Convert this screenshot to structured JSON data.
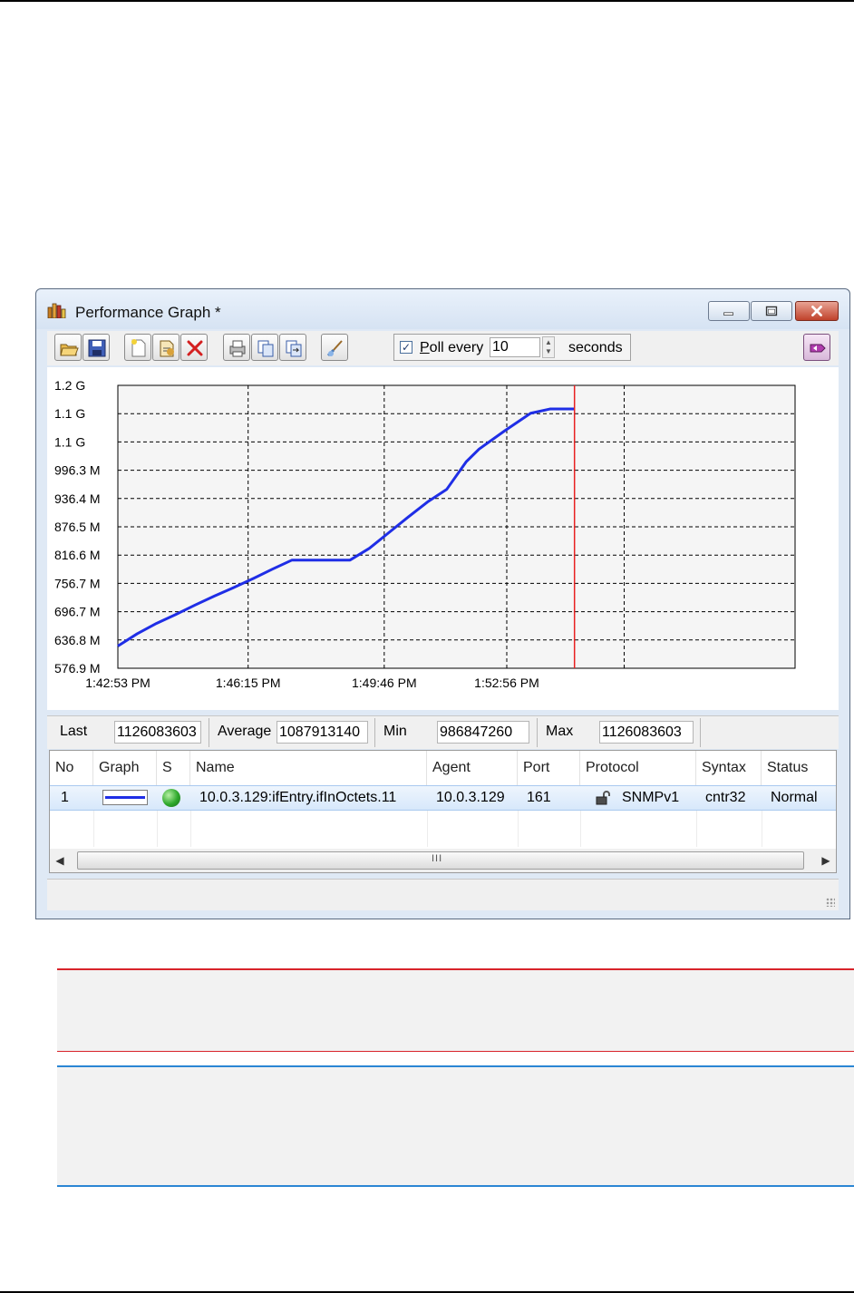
{
  "window": {
    "title": "Performance Graph *",
    "icons": {
      "app": "bar-chart-icon",
      "minimize": "minimize-icon",
      "maximize": "maximize-icon",
      "close": "close-icon"
    }
  },
  "toolbar": {
    "buttons": [
      {
        "icon": "open-folder-icon"
      },
      {
        "icon": "save-icon"
      },
      {
        "icon": "new-document-icon"
      },
      {
        "icon": "add-variable-icon"
      },
      {
        "icon": "delete-icon"
      },
      {
        "icon": "print-icon"
      },
      {
        "icon": "copy-icon"
      },
      {
        "icon": "export-icon"
      },
      {
        "icon": "properties-icon"
      },
      {
        "icon": "help-icon"
      }
    ],
    "poll": {
      "checked": true,
      "label_underlined": "P",
      "label_rest": "oll every",
      "value": "10",
      "unit": "seconds"
    }
  },
  "chart_data": {
    "type": "line",
    "title": "",
    "xlabel": "",
    "ylabel": "",
    "y_tick_labels": [
      "1.2 G",
      "1.1 G",
      "1.1 G",
      "996.3 M",
      "936.4 M",
      "876.5 M",
      "816.6 M",
      "756.7 M",
      "696.7 M",
      "636.8 M",
      "576.9 M"
    ],
    "x_tick_labels": [
      "1:42:53 PM",
      "1:46:15 PM",
      "1:49:46 PM",
      "1:52:56 PM"
    ],
    "ylim": [
      576.9,
      1176.0
    ],
    "y_unit": "M",
    "grid": "dashed",
    "cursor_time_seconds": 708,
    "series": [
      {
        "color": "#1f2ee6",
        "x_seconds": [
          0,
          30,
          60,
          90,
          120,
          150,
          180,
          210,
          240,
          270,
          300,
          330,
          360,
          390,
          420,
          450,
          480,
          510,
          540,
          560,
          600,
          640,
          670,
          700,
          708
        ],
        "values": [
          624,
          650,
          672,
          691,
          711,
          730,
          748,
          767,
          787,
          806,
          806,
          806,
          806,
          831,
          864,
          897,
          929,
          956,
          1014,
          1041,
          1080,
          1117,
          1126,
          1126,
          1126
        ]
      }
    ]
  },
  "stats": {
    "last_label": "Last",
    "last_value": "1126083603",
    "average_label": "Average",
    "average_value": "1087913140",
    "min_label": "Min",
    "min_value": "986847260",
    "max_label": "Max",
    "max_value": "1126083603"
  },
  "table": {
    "columns": [
      "No",
      "Graph",
      "S",
      "Name",
      "Agent",
      "Port",
      "Protocol",
      "Syntax",
      "Status"
    ],
    "rows": [
      {
        "no": "1",
        "graph_color": "#1f2ee6",
        "status_color": "#2ea82b",
        "name": "10.0.3.129:ifEntry.ifInOctets.11",
        "agent": "10.0.3.129",
        "port": "161",
        "protocol_icon": "lock-icon",
        "protocol": "SNMPv1",
        "syntax": "cntr32",
        "status": "Normal"
      }
    ],
    "scroll_grip": "III"
  }
}
